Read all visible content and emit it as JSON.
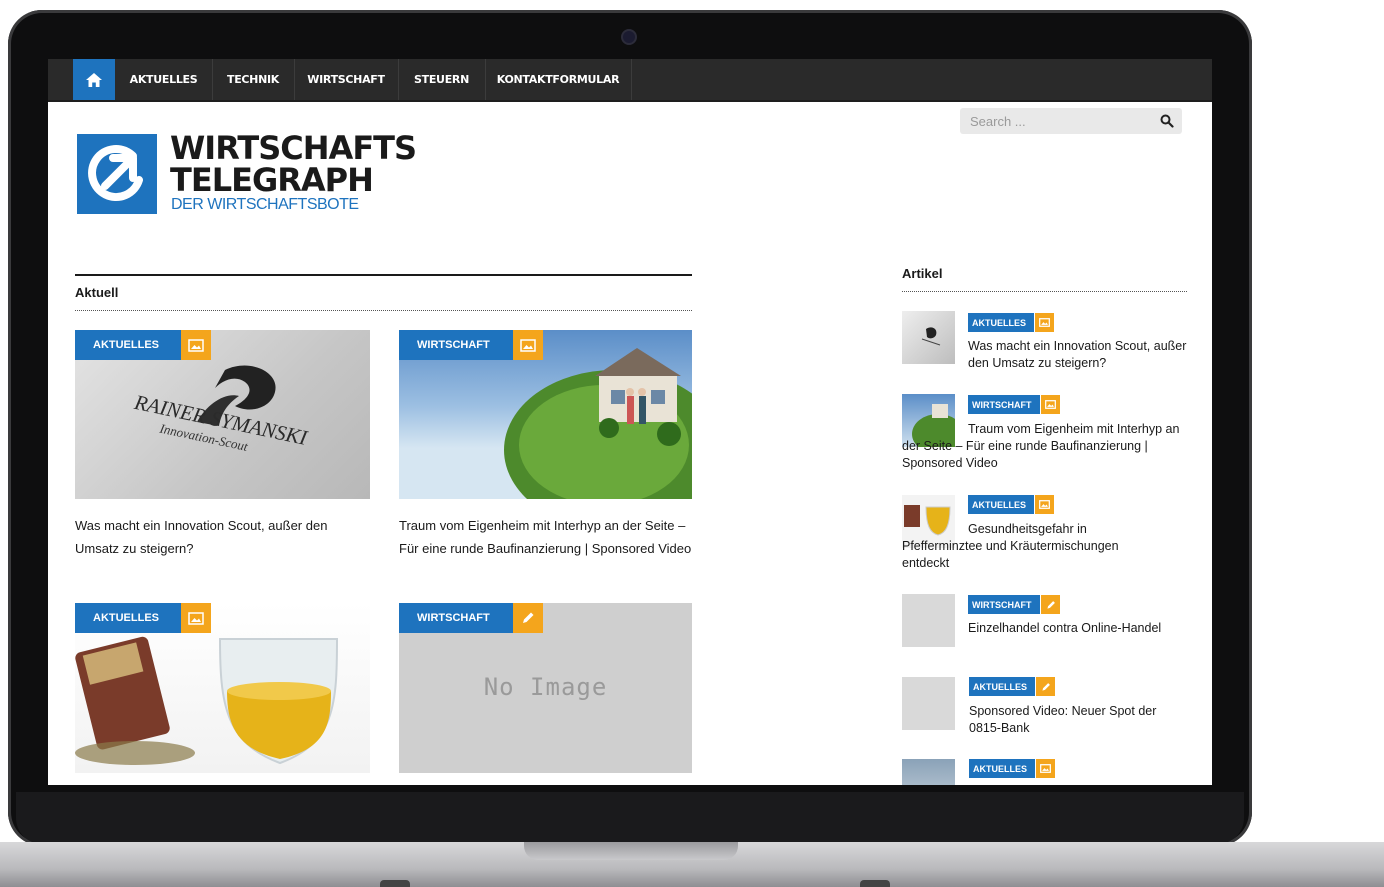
{
  "nav": {
    "items": [
      "AKTUELLES",
      "TECHNIK",
      "WIRTSCHAFT",
      "STEUERN",
      "KONTAKTFORMULAR"
    ]
  },
  "logo": {
    "line1": "WIRTSCHAFTS",
    "line2": "TELEGRAPH",
    "tagline": "DER WIRTSCHAFTSBOTE"
  },
  "search": {
    "placeholder": "Search ..."
  },
  "main": {
    "section_title": "Aktuell",
    "cards": [
      {
        "category": "AKTUELLES",
        "type_icon": "image-icon",
        "title": "Was macht ein Innovation Scout, außer den Umsatz zu steigern?",
        "image_text": [
          "RAINER SYMANSKI",
          "Innovation-Scout"
        ]
      },
      {
        "category": "WIRTSCHAFT",
        "type_icon": "image-icon",
        "title": "Traum vom Eigenheim mit Interhyp an der Seite – Für eine runde Baufinanzierung | Sponsored Video"
      },
      {
        "category": "AKTUELLES",
        "type_icon": "image-icon",
        "title": ""
      },
      {
        "category": "WIRTSCHAFT",
        "type_icon": "pencil-icon",
        "title": "",
        "image_text": [
          "No Image"
        ]
      }
    ]
  },
  "sidebar": {
    "title": "Artikel",
    "items": [
      {
        "category": "AKTUELLES",
        "type_icon": "image-icon",
        "title": "Was macht ein Innovation Scout, außer den Umsatz zu steigern?"
      },
      {
        "category": "WIRTSCHAFT",
        "type_icon": "image-icon",
        "title": "Traum vom Eigenheim mit Interhyp an der Seite – Für eine runde Baufinanzierung | Sponsored Video"
      },
      {
        "category": "AKTUELLES",
        "type_icon": "image-icon",
        "title": "Gesundheitsgefahr in Pfefferminztee und Kräutermischungen entdeckt"
      },
      {
        "category": "WIRTSCHAFT",
        "type_icon": "pencil-icon",
        "title": "Einzelhandel contra Online-Handel"
      },
      {
        "category": "AKTUELLES",
        "type_icon": "pencil-icon",
        "title": "Sponsored Video: Neuer Spot der 0815-Bank"
      },
      {
        "category": "AKTUELLES",
        "type_icon": "image-icon",
        "title": ""
      }
    ]
  },
  "colors": {
    "accent_blue": "#1e73be",
    "accent_orange": "#f4a51c",
    "nav_bg": "#2a2a2a"
  }
}
